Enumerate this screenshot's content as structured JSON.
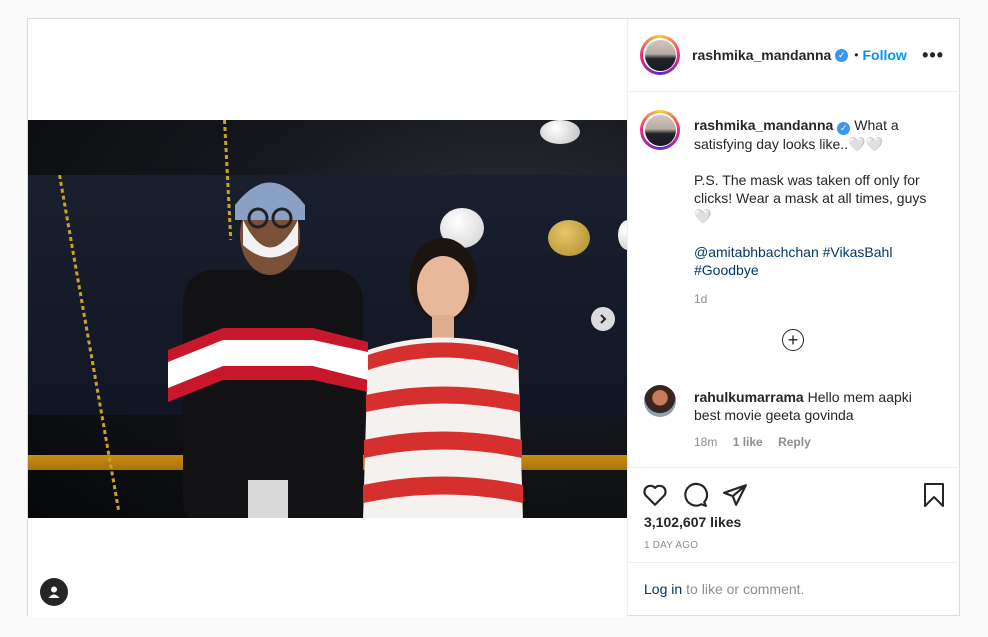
{
  "post": {
    "author": "rashmika_mandanna",
    "follow_label": "Follow",
    "separator": "•",
    "more_label": "•••"
  },
  "caption": {
    "author": "rashmika_mandanna",
    "line1": "What a satisfying day looks like..🤍🤍",
    "line2": "P.S. The mask was taken off only for clicks! Wear a mask at all times, guys 🤍",
    "mention": "@amitabhbachchan",
    "tag1": "#VikasBahl",
    "tag2": "#Goodbye",
    "time": "1d"
  },
  "comment": {
    "author": "rahulkumarrama",
    "text": "Hello mem aapki best movie geeta govinda",
    "time": "18m",
    "likes": "1 like",
    "reply": "Reply"
  },
  "load_more_symbol": "+",
  "stats": {
    "likes": "3,102,607 likes",
    "ago": "1 DAY AGO"
  },
  "login": {
    "link": "Log in",
    "text": "to like or comment."
  },
  "icons": {
    "heart": "heart-icon",
    "comment": "comment-icon",
    "share": "share-icon",
    "save": "bookmark-icon",
    "next": "chevron-right-icon",
    "tag": "user-icon"
  }
}
